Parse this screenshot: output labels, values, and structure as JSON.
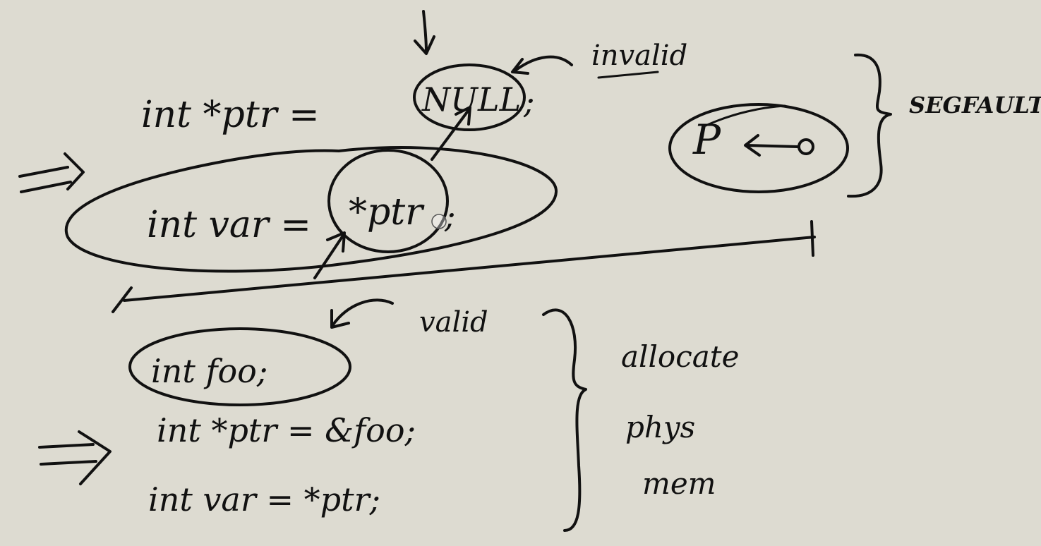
{
  "colors": {
    "background": "#dddbd1",
    "ink": "#111111"
  },
  "top": {
    "declaration": "int *ptr = ",
    "null_value": "NULL",
    "semicolon": ";",
    "annotation": "invalid",
    "deref_line_prefix": "int var = ",
    "deref_expr": "*ptr",
    "deref_semicolon": ";",
    "segfault_label": "SEGFAULT",
    "pointer_letter": "P"
  },
  "bottom": {
    "line1": "int foo;",
    "line2": "int *ptr = &foo;",
    "line3": "int var = *ptr;",
    "annotation": "valid",
    "note_1": "allocate",
    "note_2": "phys",
    "note_3": "mem"
  },
  "icons": {
    "implies_top": "implies-arrow-icon",
    "implies_bottom": "implies-arrow-icon"
  }
}
